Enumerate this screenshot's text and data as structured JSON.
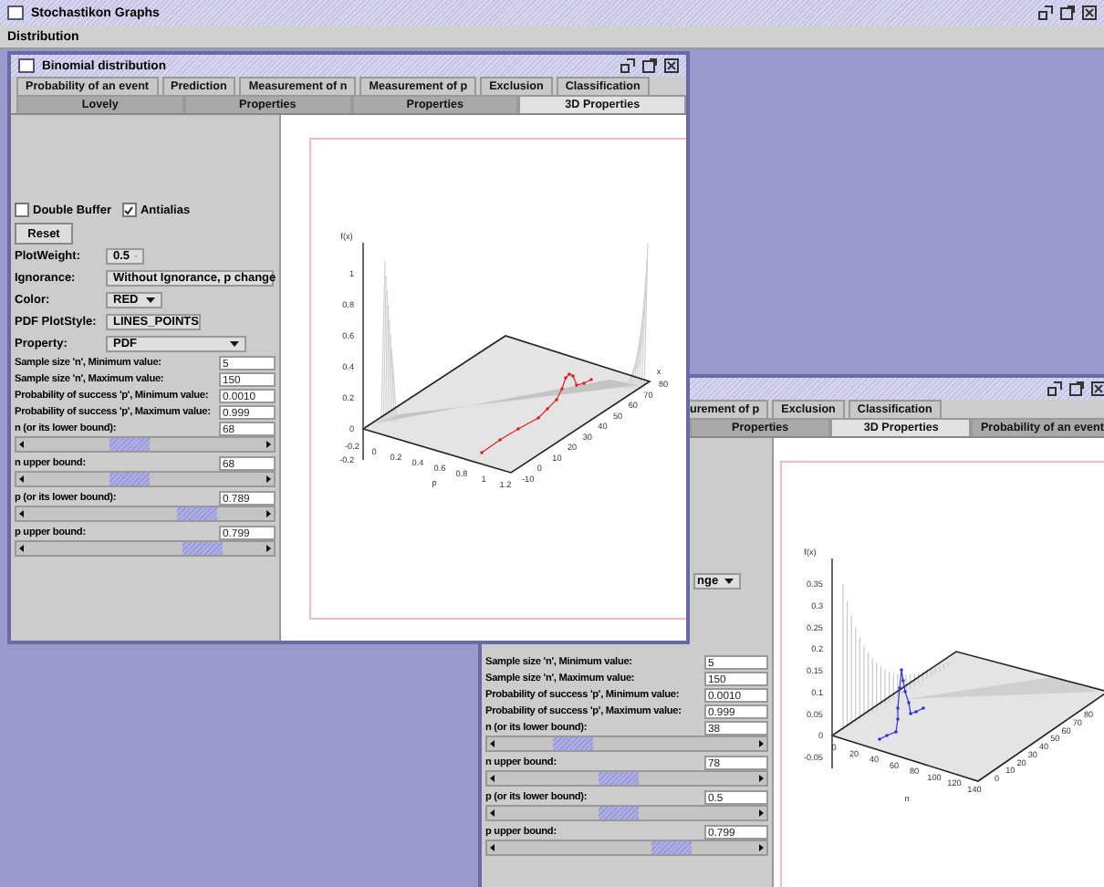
{
  "app": {
    "title": "Stochastikon Graphs",
    "menu": [
      "Distribution"
    ]
  },
  "windows": [
    {
      "title": "Binomial distribution",
      "tab_rows": [
        [
          {
            "label": "Probability of an event",
            "selected": false
          },
          {
            "label": "Prediction",
            "selected": false
          },
          {
            "label": "Measurement of n",
            "selected": false
          },
          {
            "label": "Measurement of p",
            "selected": false
          },
          {
            "label": "Exclusion",
            "selected": false
          },
          {
            "label": "Classification",
            "selected": false
          }
        ],
        [
          {
            "label": "Lovely",
            "selected": false
          },
          {
            "label": "Properties",
            "selected": false
          },
          {
            "label": "Properties",
            "selected": false
          },
          {
            "label": "3D Properties",
            "selected": true
          }
        ]
      ],
      "checkboxes": [
        {
          "label": "Double Buffer",
          "checked": false
        },
        {
          "label": "Antialias",
          "checked": true
        }
      ],
      "button": "Reset",
      "combos": [
        {
          "label": "PlotWeight:",
          "value": "0.5"
        },
        {
          "label": "Ignorance:",
          "value": "Without Ignorance, p change"
        },
        {
          "label": "Color:",
          "value": "RED"
        },
        {
          "label": "PDF PlotStyle:",
          "value": "LINES_POINTS"
        },
        {
          "label": "Property:",
          "value": "PDF"
        }
      ],
      "rows": [
        {
          "kind": "field",
          "label": "Sample size 'n', Minimum value:",
          "value": "5"
        },
        {
          "kind": "field",
          "label": "Sample size 'n', Maximum value:",
          "value": "150"
        },
        {
          "kind": "field",
          "label": "Probability of success 'p', Minimum value:",
          "value": "0.0010"
        },
        {
          "kind": "field",
          "label": "Probability of success 'p', Maximum value:",
          "value": "0.999"
        },
        {
          "kind": "slider",
          "label": "n (or its lower bound):",
          "value": "68",
          "level": 0.42
        },
        {
          "kind": "slider",
          "label": "n upper bound:",
          "value": "68",
          "level": 0.42
        },
        {
          "kind": "slider",
          "label": "p (or its lower bound):",
          "value": "0.789",
          "level": 0.77
        },
        {
          "kind": "slider",
          "label": "p upper bound:",
          "value": "0.799",
          "level": 0.79
        }
      ],
      "plot": {
        "ylabel": "f(x)",
        "yticks": [
          "1",
          "0.8",
          "0.6",
          "0.4",
          "0.2",
          "0",
          "-0.2"
        ],
        "front_ticks": [
          "-0.2",
          "0",
          "0.2",
          "0.4",
          "0.6",
          "0.8",
          "1",
          "1.2"
        ],
        "front_label": "p",
        "side_ticks": [
          "-10",
          "0",
          "10",
          "20",
          "30",
          "40",
          "50",
          "60",
          "70",
          "80"
        ],
        "side_label": "x"
      }
    },
    {
      "tab_rows": [
        [
          {
            "label": "urement of p",
            "selected": false
          },
          {
            "label": "Exclusion",
            "selected": false
          },
          {
            "label": "Classification",
            "selected": false
          }
        ],
        [
          {
            "label": "Properties",
            "selected": false
          },
          {
            "label": "3D Properties",
            "selected": true
          },
          {
            "label": "Probability of an event",
            "selected": false
          }
        ]
      ],
      "combos": [
        {
          "value": "nge"
        }
      ],
      "rows": [
        {
          "kind": "field",
          "label": "Sample size 'n', Minimum value:",
          "value": "5"
        },
        {
          "kind": "field",
          "label": "Sample size 'n', Maximum value:",
          "value": "150"
        },
        {
          "kind": "field",
          "label": "Probability of success 'p', Minimum value:",
          "value": "0.0010"
        },
        {
          "kind": "field",
          "label": "Probability of success 'p', Maximum value:",
          "value": "0.999"
        },
        {
          "kind": "slider",
          "label": "n (or its lower bound):",
          "value": "38",
          "level": 0.25
        },
        {
          "kind": "slider",
          "label": "n upper bound:",
          "value": "78",
          "level": 0.46
        },
        {
          "kind": "slider",
          "label": "p (or its lower bound):",
          "value": "0.5",
          "level": 0.46
        },
        {
          "kind": "slider",
          "label": "p upper bound:",
          "value": "0.799",
          "level": 0.71
        }
      ],
      "plot": {
        "ylabel": "f(x)",
        "yticks": [
          "0.35",
          "0.3",
          "0.25",
          "0.2",
          "0.15",
          "0.1",
          "0.05",
          "0",
          "-0.05"
        ],
        "front_ticks": [
          "0",
          "20",
          "40",
          "60",
          "80",
          "100",
          "120",
          "140"
        ],
        "front_label": "n",
        "side_ticks": [
          "0",
          "10",
          "20",
          "30",
          "40",
          "50",
          "60",
          "70",
          "80"
        ]
      }
    }
  ]
}
